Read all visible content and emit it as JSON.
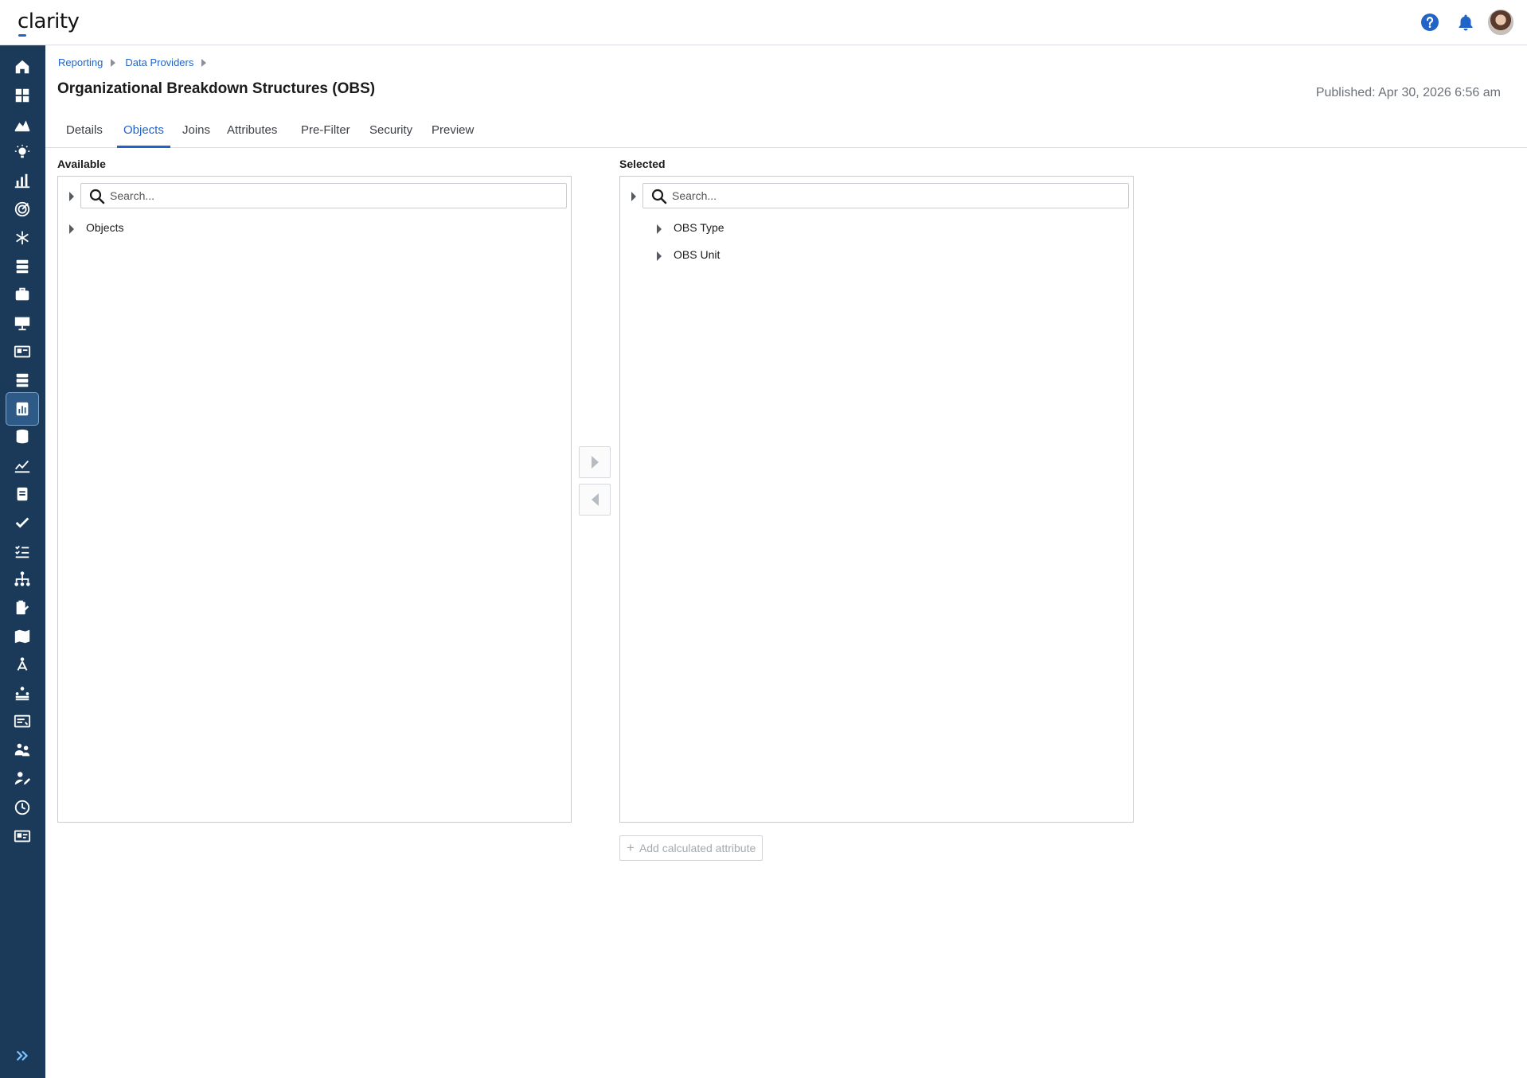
{
  "app": {
    "logo_text": "clarity"
  },
  "breadcrumb": [
    {
      "label": "Reporting"
    },
    {
      "label": "Data Providers"
    }
  ],
  "page": {
    "title": "Organizational Breakdown Structures (OBS)",
    "published": "Published: Apr 30, 2026 6:56 am"
  },
  "tabs": [
    {
      "label": "Details",
      "active": false
    },
    {
      "label": "Objects",
      "active": true
    },
    {
      "label": "Joins",
      "active": false
    },
    {
      "label": "Attributes",
      "active": false
    },
    {
      "label": "Pre-Filter",
      "active": false
    },
    {
      "label": "Security",
      "active": false
    },
    {
      "label": "Preview",
      "active": false
    }
  ],
  "available": {
    "label": "Available",
    "search_placeholder": "Search...",
    "items": [
      "Objects"
    ]
  },
  "selected": {
    "label": "Selected",
    "search_placeholder": "Search...",
    "items": [
      "OBS Type",
      "OBS Unit"
    ]
  },
  "actions": {
    "add_calculated_attribute": "Add calculated attribute",
    "add_icon": "+"
  },
  "sidebar": {
    "items": [
      "home-icon",
      "dashboard-icon",
      "area-chart-icon",
      "lightbulb-icon",
      "bar-chart-icon",
      "target-icon",
      "hub-icon",
      "server-icon",
      "briefcase-icon",
      "presentation-icon",
      "id-card-icon",
      "database-stack-icon",
      "reporting-icon",
      "database-icon",
      "line-chart-icon",
      "clipboard-icon",
      "check-icon",
      "checklist-icon",
      "org-chart-icon",
      "timesheet-icon",
      "book-icon",
      "hierarchy-icon",
      "team-icon",
      "forms-icon",
      "people-icon",
      "user-edit-icon",
      "clock-icon",
      "settings-card-icon"
    ],
    "active_index": 12
  },
  "colors": {
    "sidebar_bg": "#1b3a5a",
    "accent": "#2264c6"
  }
}
